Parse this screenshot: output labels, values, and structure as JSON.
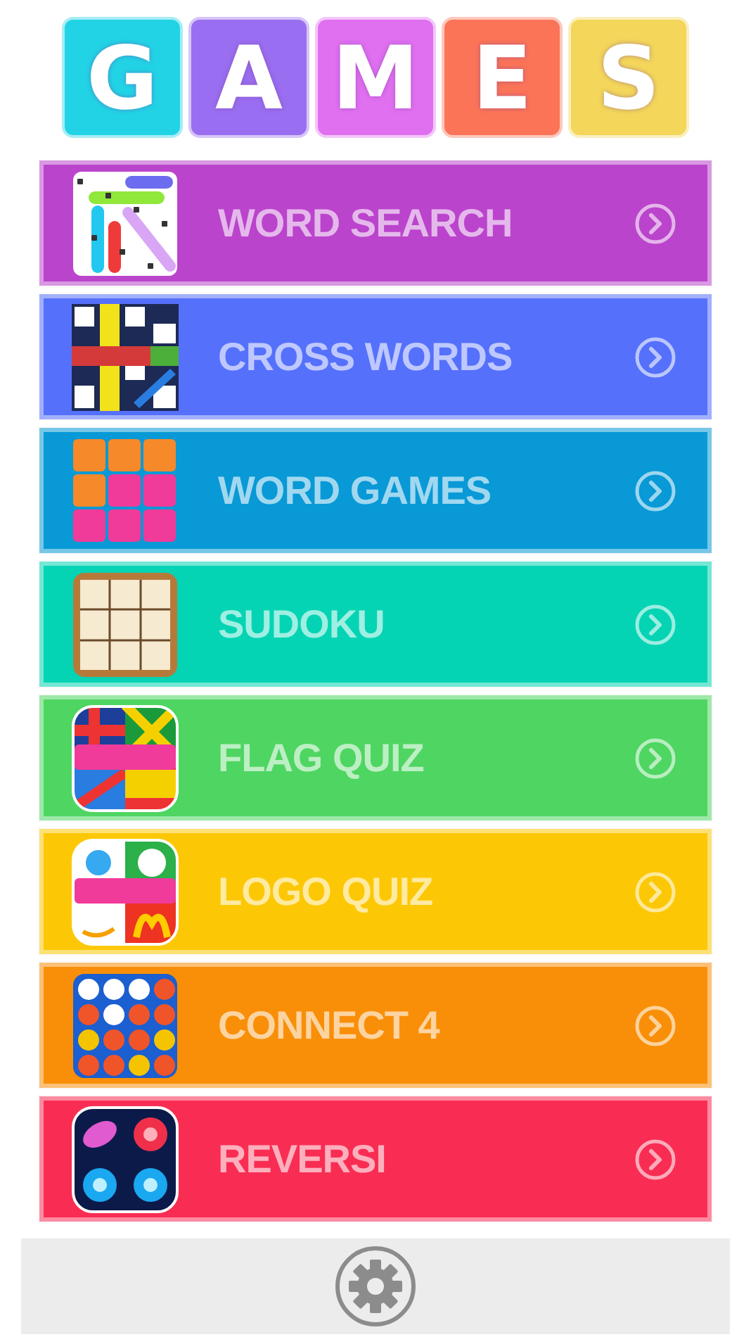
{
  "logo": {
    "letters": [
      {
        "letter": "G",
        "color": "#22d3e6"
      },
      {
        "letter": "A",
        "color": "#9a6ef0"
      },
      {
        "letter": "M",
        "color": "#e070f0"
      },
      {
        "letter": "E",
        "color": "#fb7458"
      },
      {
        "letter": "S",
        "color": "#f3d65a"
      }
    ]
  },
  "games": [
    {
      "label": "WORD SEARCH",
      "color": "#bb44cc",
      "kind": "wordsearch"
    },
    {
      "label": "CROSS WORDS",
      "color": "#5570fb",
      "kind": "crossword"
    },
    {
      "label": "WORD GAMES",
      "color": "#0899d6",
      "kind": "tiles"
    },
    {
      "label": "SUDOKU",
      "color": "#05d4b4",
      "kind": "sudoku"
    },
    {
      "label": "FLAG QUIZ",
      "color": "#4fd562",
      "kind": "flags"
    },
    {
      "label": "LOGO QUIZ",
      "color": "#fcc806",
      "kind": "quiz"
    },
    {
      "label": "CONNECT 4",
      "color": "#f98f08",
      "kind": "connect"
    },
    {
      "label": "REVERSI",
      "color": "#f92d53",
      "kind": "reversi"
    }
  ],
  "footer": {
    "settings": true
  }
}
